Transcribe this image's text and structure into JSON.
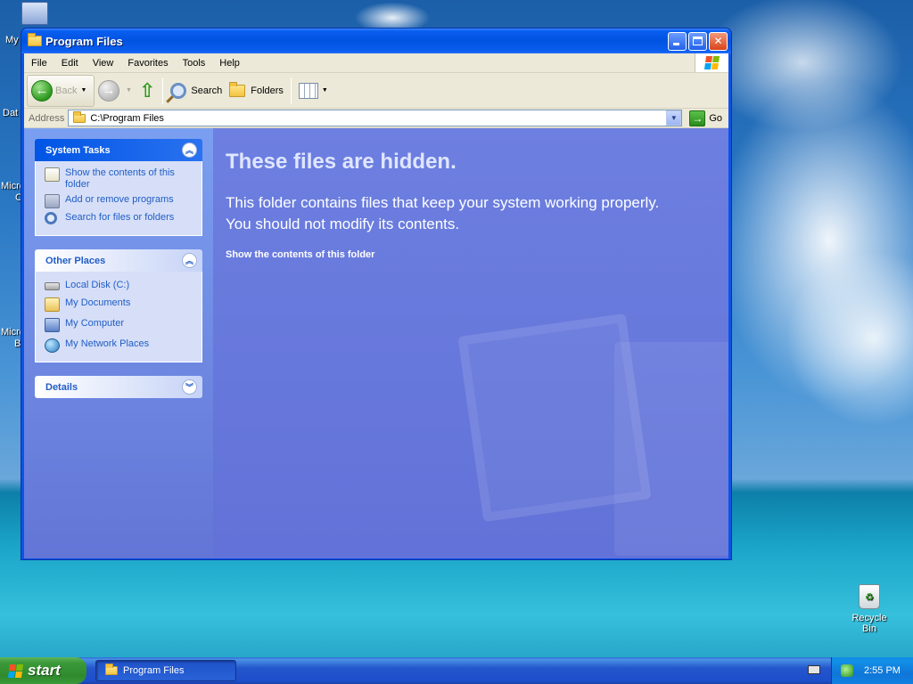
{
  "desktop": {
    "fragments": [
      "My",
      "Dat",
      "Micro",
      "C",
      "Micro",
      "B"
    ],
    "recycle_bin": {
      "label": "Recycle Bin",
      "icon": "recycle-bin-icon"
    }
  },
  "window": {
    "title": "Program Files",
    "icon": "folder-icon",
    "controls": {
      "minimize": "minimize-icon",
      "maximize": "maximize-icon",
      "close": "✕"
    },
    "menu": [
      "File",
      "Edit",
      "View",
      "Favorites",
      "Tools",
      "Help"
    ],
    "toolbar": {
      "back_label": "Back",
      "search_label": "Search",
      "folders_label": "Folders"
    },
    "address": {
      "label": "Address",
      "value": "C:\\Program Files",
      "go_label": "Go"
    },
    "task_pane": {
      "system_tasks": {
        "title": "System Tasks",
        "items": [
          {
            "label": "Show the contents of this folder",
            "icon": "show-contents-icon"
          },
          {
            "label": "Add or remove programs",
            "icon": "add-remove-icon"
          },
          {
            "label": "Search for files or folders",
            "icon": "search-icon"
          }
        ]
      },
      "other_places": {
        "title": "Other Places",
        "items": [
          {
            "label": "Local Disk (C:)",
            "icon": "disk-icon"
          },
          {
            "label": "My Documents",
            "icon": "documents-icon"
          },
          {
            "label": "My Computer",
            "icon": "computer-icon"
          },
          {
            "label": "My Network Places",
            "icon": "network-icon"
          }
        ]
      },
      "details": {
        "title": "Details"
      }
    },
    "content": {
      "heading": "These files are hidden.",
      "message_line1": "This folder contains files that keep your system working properly.",
      "message_line2": "You should not modify its contents.",
      "show_link": "Show the contents of this folder"
    }
  },
  "taskbar": {
    "start_label": "start",
    "tasks": [
      {
        "label": "Program Files",
        "icon": "folder-icon"
      }
    ],
    "clock": "2:55 PM"
  },
  "colors": {
    "titlebar": "#0053e0",
    "content_bg": "#6272d8",
    "link": "#215dc6",
    "taskbar": "#245edb",
    "start_green": "#3c9a3a"
  }
}
